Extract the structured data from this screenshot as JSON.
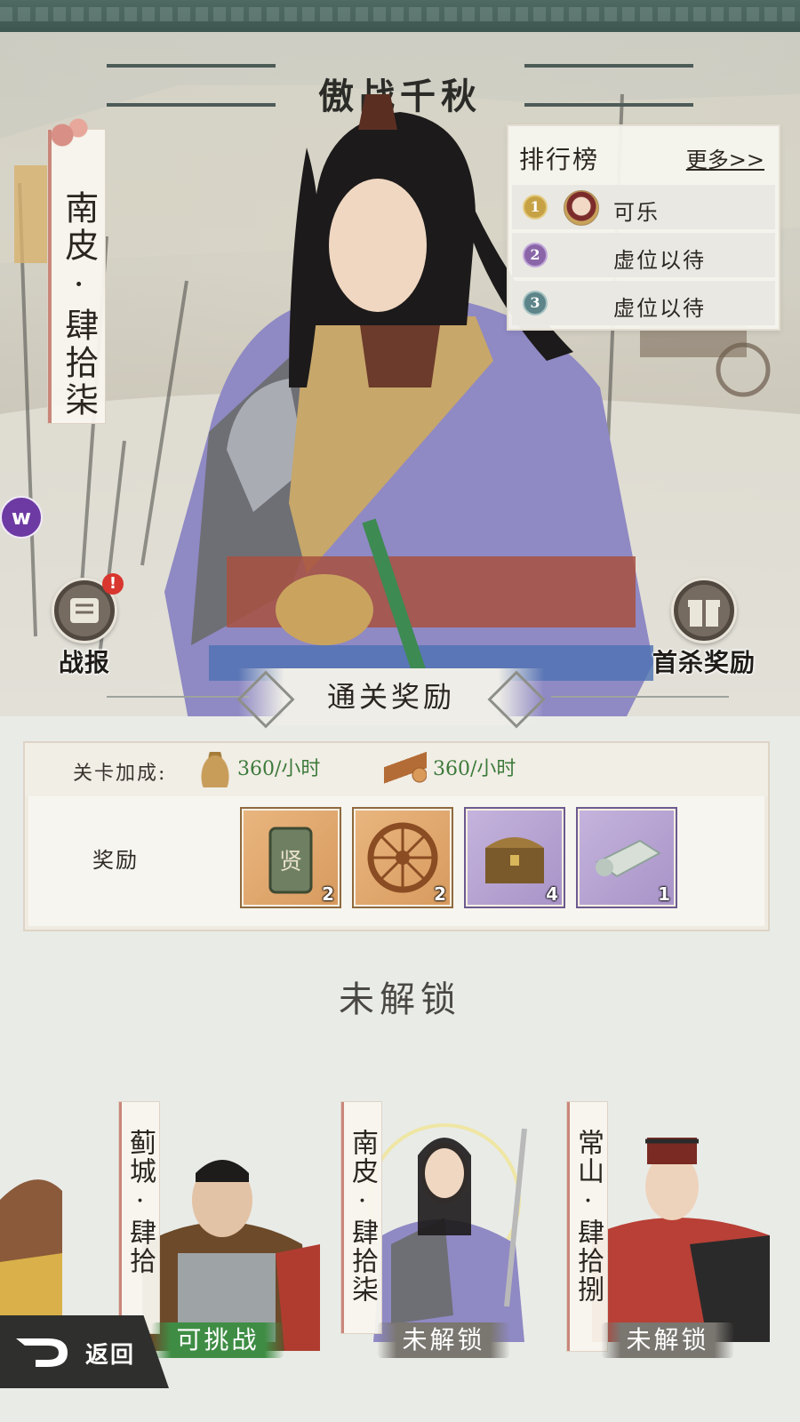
{
  "banner_title": "傲战千秋",
  "stage": {
    "name_vertical": "南皮·肆拾柒"
  },
  "leaderboard": {
    "title": "排行榜",
    "more": "更多>>",
    "rows": [
      {
        "rank": "1",
        "name": "可乐",
        "has_avatar": true
      },
      {
        "rank": "2",
        "name": "虚位以待",
        "has_avatar": false
      },
      {
        "rank": "3",
        "name": "虚位以待",
        "has_avatar": false
      }
    ]
  },
  "side_buttons": {
    "battle_report": {
      "label": "战报",
      "icon": "scroll-icon",
      "alert": "!"
    },
    "first_kill": {
      "label": "首杀奖励",
      "icon": "gift-icon"
    }
  },
  "purple_badge": "w",
  "rewards": {
    "header": "通关奖励",
    "bonus_label": "关卡加成:",
    "bonus_items": [
      {
        "icon": "grain-sack-icon",
        "value": "360/小时"
      },
      {
        "icon": "wood-logs-icon",
        "value": "360/小时"
      }
    ],
    "reward_label": "奖励",
    "items": [
      {
        "icon": "token-tag-icon",
        "glyph": "贤",
        "qty": "2",
        "rarity": "tan"
      },
      {
        "icon": "wheel-icon",
        "qty": "2",
        "rarity": "tan"
      },
      {
        "icon": "treasure-chest-icon",
        "qty": "4",
        "rarity": "purple"
      },
      {
        "icon": "scroll-bundle-icon",
        "qty": "1",
        "rarity": "purple"
      }
    ]
  },
  "locked_title": "未解锁",
  "stage_cards": [
    {
      "name_vertical": "蓟城·肆拾",
      "status": "可挑战",
      "status_color": "#3f8d45"
    },
    {
      "name_vertical": "南皮·肆拾柒",
      "status": "未解锁",
      "status_color": "#7a7670"
    },
    {
      "name_vertical": "常山·肆拾捌",
      "status": "未解锁",
      "status_color": "#7a7670"
    }
  ],
  "back_button": {
    "label": "返回"
  },
  "colors": {
    "frame": "#3d5650",
    "accent_red": "#c9877a",
    "green": "#3f8d45"
  }
}
